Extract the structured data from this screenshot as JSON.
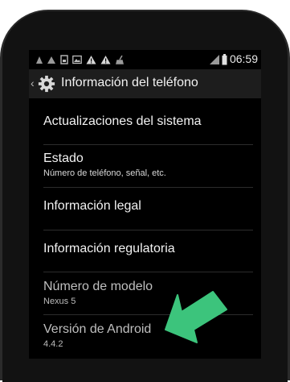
{
  "status_bar": {
    "time": "06:59",
    "icons": [
      "notification-icon",
      "notification-icon",
      "sim-icon",
      "image-icon",
      "warning-icon",
      "warning-icon",
      "broom-icon",
      "signal-icon",
      "battery-icon"
    ]
  },
  "action_bar": {
    "title": "Información del teléfono",
    "icons": [
      "back-caret-icon",
      "settings-gear-icon"
    ]
  },
  "items": [
    {
      "title": "Actualizaciones del sistema",
      "subtitle": ""
    },
    {
      "title": "Estado",
      "subtitle": "Número de teléfono, señal, etc."
    },
    {
      "title": "Información legal",
      "subtitle": ""
    },
    {
      "title": "Información regulatoria",
      "subtitle": ""
    },
    {
      "title": "Número de modelo",
      "subtitle": "Nexus 5"
    },
    {
      "title": "Versión de Android",
      "subtitle": "4.4.2"
    }
  ],
  "overlay": {
    "arrow_color": "#3cc47c",
    "icon": "green-arrow-icon"
  },
  "colors": {
    "background": "#000000",
    "action_bar": "#1d1d1d",
    "divider": "#2c2c2c",
    "text": "#f2f2f2"
  }
}
